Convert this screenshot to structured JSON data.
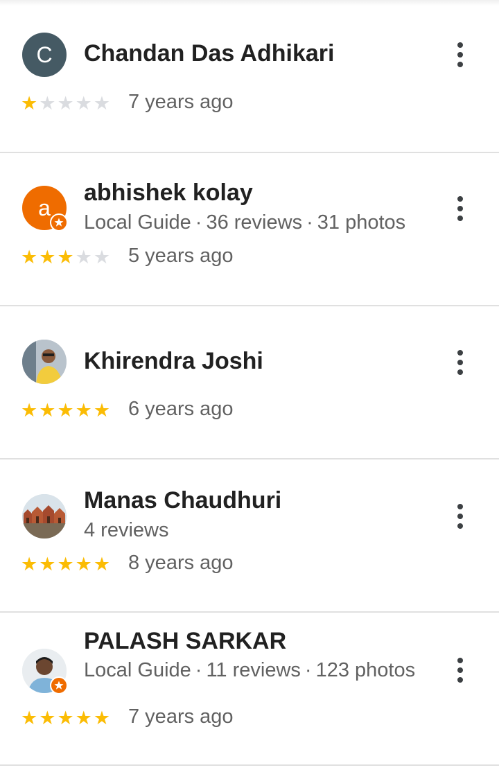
{
  "reviews": [
    {
      "name": "Chandan Das Adhikari",
      "avatar_letter": "C",
      "avatar_color": "#455a64",
      "avatar_icon": "letter-avatar",
      "local_guide": false,
      "meta": [],
      "rating": 1,
      "time": "7 years ago"
    },
    {
      "name": "abhishek kolay",
      "avatar_letter": "a",
      "avatar_color": "#ef6c00",
      "avatar_icon": "letter-avatar",
      "local_guide": true,
      "meta": [
        "Local Guide",
        "36 reviews",
        "31 photos"
      ],
      "rating": 3,
      "time": "5 years ago"
    },
    {
      "name": "Khirendra Joshi",
      "avatar_icon": "person-photo-avatar",
      "local_guide": false,
      "meta": [],
      "rating": 5,
      "time": "6 years ago"
    },
    {
      "name": "Manas Chaudhuri",
      "avatar_icon": "temple-photo-avatar",
      "local_guide": false,
      "meta": [
        "4 reviews"
      ],
      "rating": 5,
      "time": "8 years ago"
    },
    {
      "name": "PALASH SARKAR",
      "avatar_icon": "person-photo-avatar",
      "local_guide": true,
      "meta": [
        "Local Guide",
        "11 reviews",
        "123 photos"
      ],
      "rating": 5,
      "time": "7 years ago"
    }
  ],
  "colors": {
    "star_on": "#fbbc04",
    "star_off": "#dadce0",
    "local_guide_badge": "#ef6c00"
  }
}
